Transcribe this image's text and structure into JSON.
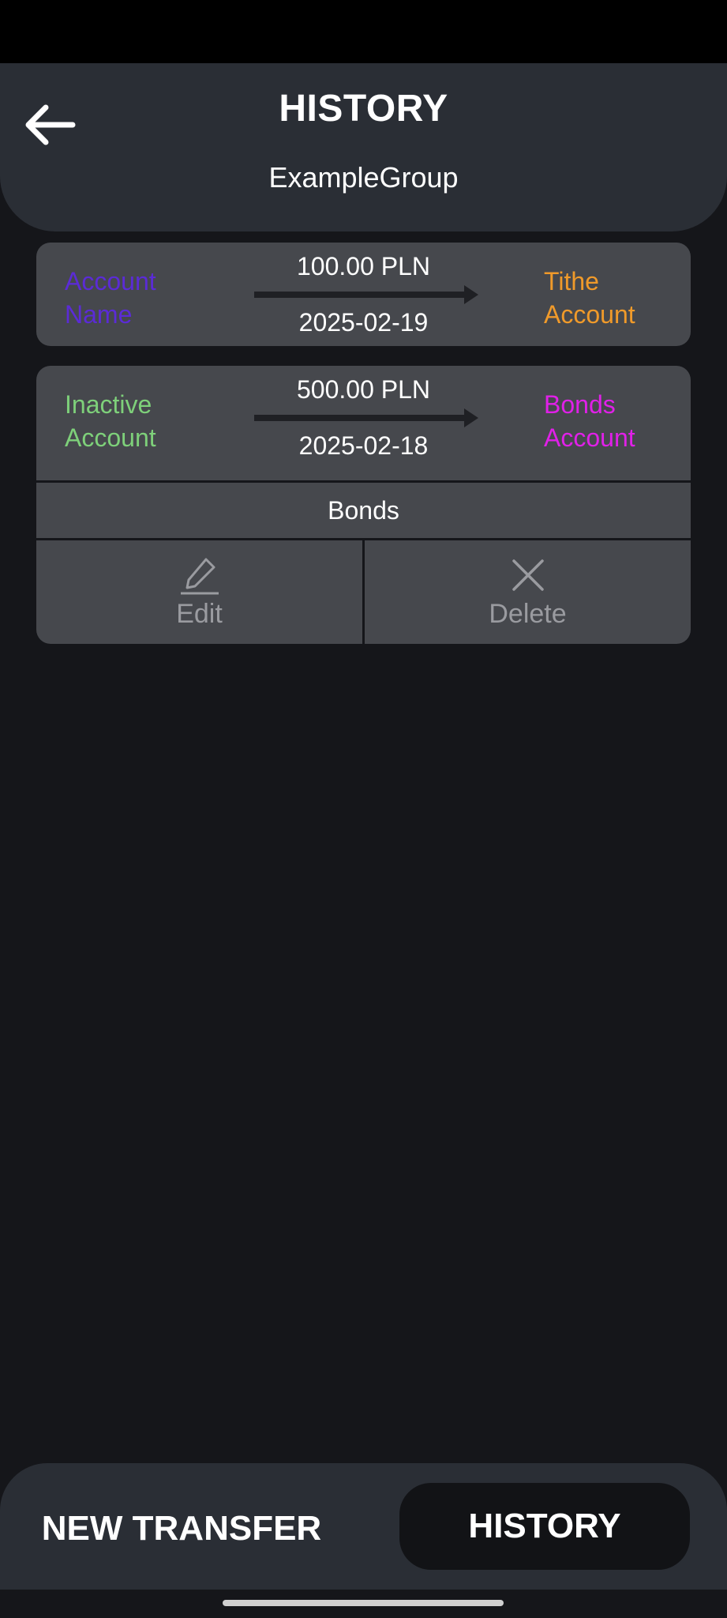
{
  "header": {
    "title": "HISTORY",
    "subtitle": "ExampleGroup",
    "back_icon": "arrow-left-icon"
  },
  "transfers": [
    {
      "from": "Account Name",
      "from_color": "#5b2bd6",
      "amount": "100.00 PLN",
      "date": "2025-02-19",
      "to": "Tithe Account",
      "to_color": "#f09a2a"
    },
    {
      "from": "Inactive Account",
      "from_color": "#7ed07a",
      "amount": "500.00 PLN",
      "date": "2025-02-18",
      "to": "Bonds Account",
      "to_color": "#e020e8",
      "memo": "Bonds",
      "edit_label": "Edit",
      "edit_icon": "pencil-icon",
      "delete_label": "Delete",
      "delete_icon": "close-icon"
    }
  ],
  "bottom_nav": {
    "new_transfer": "NEW TRANSFER",
    "history": "HISTORY"
  },
  "colors": {
    "background": "#15161a",
    "header": "#2a2e35",
    "card": "#46484d"
  }
}
